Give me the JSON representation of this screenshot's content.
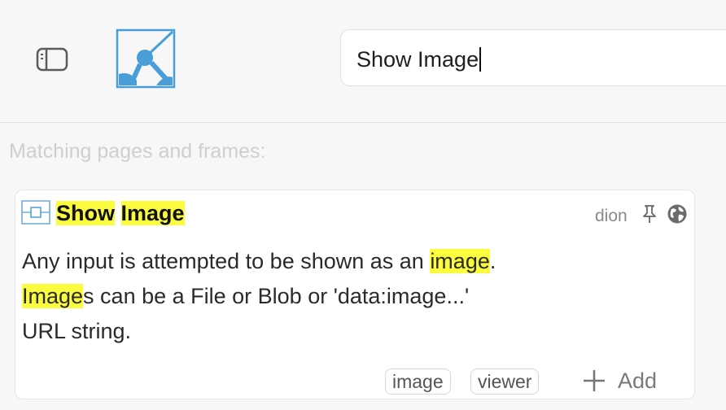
{
  "search": {
    "value": "Show Image"
  },
  "results": {
    "heading": "Matching pages and frames:",
    "item": {
      "title_segments": [
        {
          "text": "Show",
          "highlight": true
        },
        {
          "text": " ",
          "highlight": false
        },
        {
          "text": "Image",
          "highlight": true
        }
      ],
      "author": "dion",
      "description_lines": [
        [
          {
            "text": "Any input is attempted to be shown as an ",
            "highlight": false
          },
          {
            "text": "image",
            "highlight": true
          },
          {
            "text": ".",
            "highlight": false
          }
        ],
        [
          {
            "text": "Image",
            "highlight": true
          },
          {
            "text": "s can be a File or Blob or 'data:image...'",
            "highlight": false
          }
        ],
        [
          {
            "text": "URL string.",
            "highlight": false
          }
        ]
      ],
      "tags": [
        "image",
        "viewer"
      ],
      "add_label": "Add"
    }
  },
  "icons": {
    "sidebar_toggle": "sidebar-toggle-icon",
    "logo": "app-logo",
    "frame": "frame-icon",
    "pin": "pin-icon",
    "globe": "globe-icon",
    "plus": "plus-icon"
  },
  "colors": {
    "highlight": "#fcfc3f",
    "logo_blue": "#4a9ed8",
    "muted_text": "#cfcfcf"
  }
}
